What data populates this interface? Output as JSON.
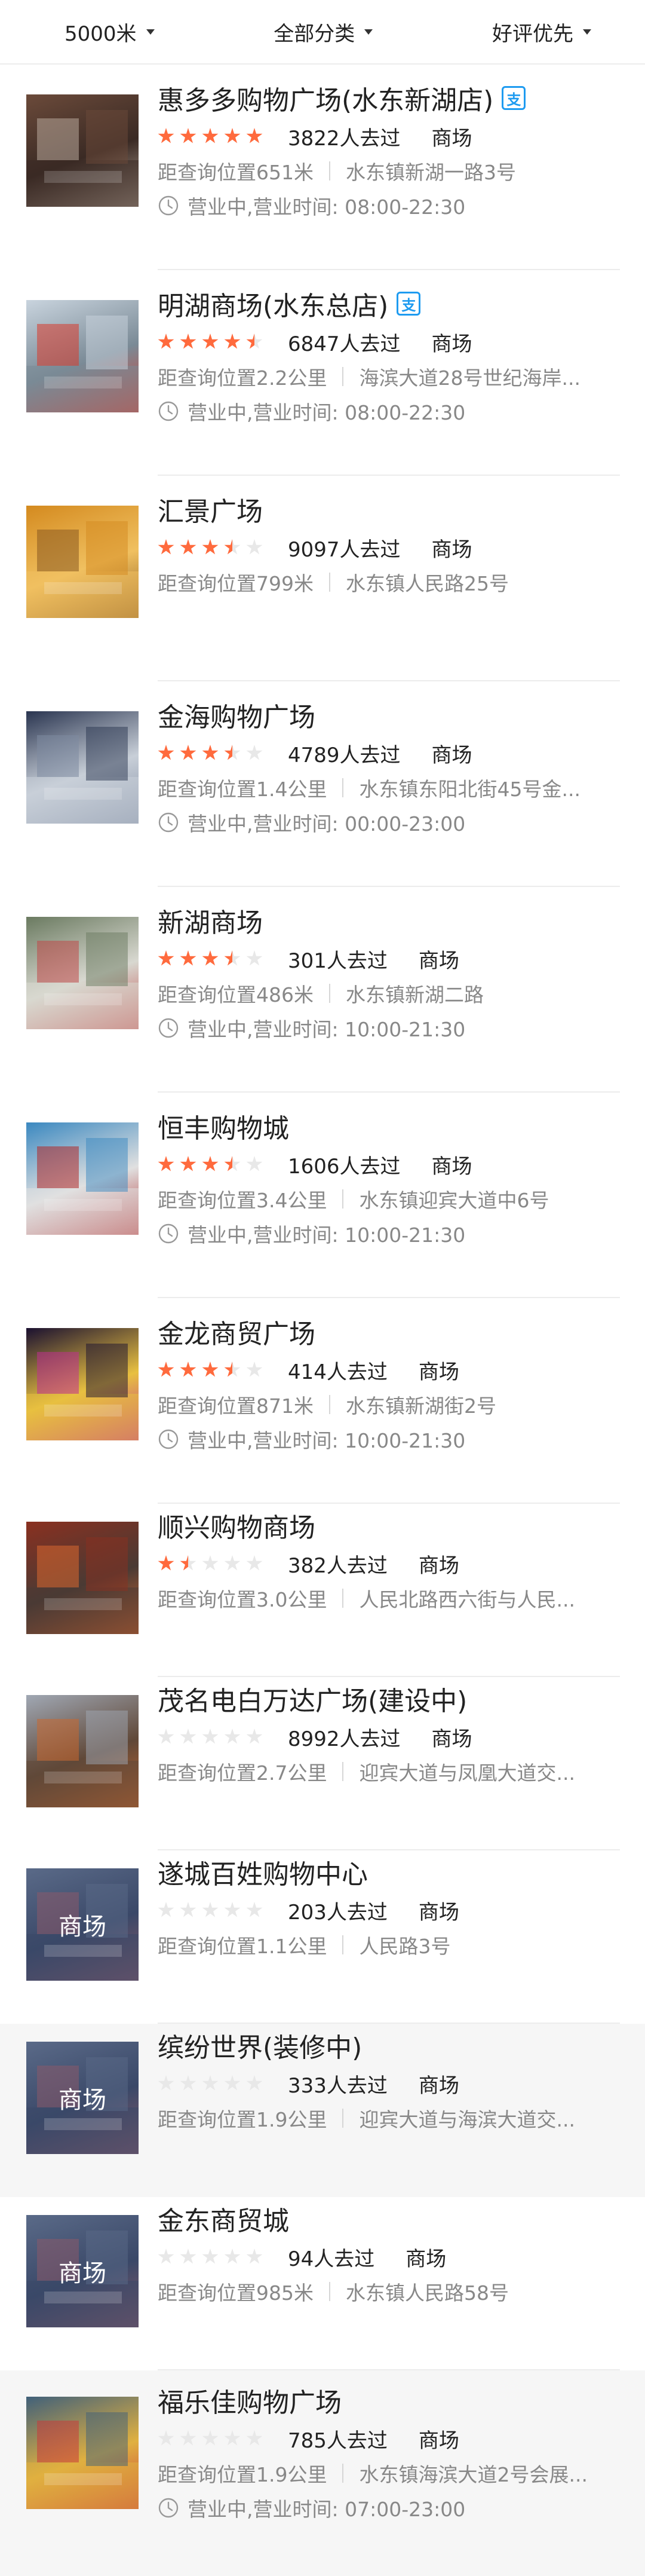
{
  "filters": {
    "distance": "5000米",
    "category": "全部分类",
    "sort": "好评优先"
  },
  "icons": {
    "caret": "caret-down-icon",
    "pay": "alipay-icon",
    "clock": "clock-icon",
    "star": "star-icon"
  },
  "colors": {
    "star_active": "#ff6a3d",
    "star_inactive": "#e8e8e8",
    "pay_icon": "#1e9bf0",
    "secondary_text": "#888888"
  },
  "stores": [
    {
      "name": "惠多多购物广场(水东新湖店)",
      "has_pay": true,
      "rating": 5,
      "visitors": "3822人去过",
      "category": "商场",
      "distance": "距查询位置651米",
      "address": "水东镇新湖一路3号",
      "hours": "营业中,营业时间: 08:00-22:30",
      "thumb_text": ""
    },
    {
      "name": "明湖商场(水东总店)",
      "has_pay": true,
      "rating": 4.5,
      "visitors": "6847人去过",
      "category": "商场",
      "distance": "距查询位置2.2公里",
      "address": "海滨大道28号世纪海岸...",
      "hours": "营业中,营业时间: 08:00-22:30",
      "thumb_text": ""
    },
    {
      "name": "汇景广场",
      "has_pay": false,
      "rating": 3.5,
      "visitors": "9097人去过",
      "category": "商场",
      "distance": "距查询位置799米",
      "address": "水东镇人民路25号",
      "hours": "",
      "thumb_text": ""
    },
    {
      "name": "金海购物广场",
      "has_pay": false,
      "rating": 3.5,
      "visitors": "4789人去过",
      "category": "商场",
      "distance": "距查询位置1.4公里",
      "address": "水东镇东阳北街45号金...",
      "hours": "营业中,营业时间: 00:00-23:00",
      "thumb_text": ""
    },
    {
      "name": "新湖商场",
      "has_pay": false,
      "rating": 3.5,
      "visitors": "301人去过",
      "category": "商场",
      "distance": "距查询位置486米",
      "address": "水东镇新湖二路",
      "hours": "营业中,营业时间: 10:00-21:30",
      "thumb_text": ""
    },
    {
      "name": "恒丰购物城",
      "has_pay": false,
      "rating": 3.5,
      "visitors": "1606人去过",
      "category": "商场",
      "distance": "距查询位置3.4公里",
      "address": "水东镇迎宾大道中6号",
      "hours": "营业中,营业时间: 10:00-21:30",
      "thumb_text": ""
    },
    {
      "name": "金龙商贸广场",
      "has_pay": false,
      "rating": 3.5,
      "visitors": "414人去过",
      "category": "商场",
      "distance": "距查询位置871米",
      "address": "水东镇新湖街2号",
      "hours": "营业中,营业时间: 10:00-21:30",
      "thumb_text": ""
    },
    {
      "name": "顺兴购物商场",
      "has_pay": false,
      "rating": 1.5,
      "visitors": "382人去过",
      "category": "商场",
      "distance": "距查询位置3.0公里",
      "address": "人民北路西六街与人民...",
      "hours": "",
      "thumb_text": ""
    },
    {
      "name": "茂名电白万达广场(建设中)",
      "has_pay": false,
      "rating": 0,
      "visitors": "8992人去过",
      "category": "商场",
      "distance": "距查询位置2.7公里",
      "address": "迎宾大道与凤凰大道交...",
      "hours": "",
      "thumb_text": ""
    },
    {
      "name": "遂城百姓购物中心",
      "has_pay": false,
      "rating": 0,
      "visitors": "203人去过",
      "category": "商场",
      "distance": "距查询位置1.1公里",
      "address": "人民路3号",
      "hours": "",
      "thumb_text": "商场"
    },
    {
      "name": "缤纷世界(装修中)",
      "has_pay": false,
      "rating": 0,
      "visitors": "333人去过",
      "category": "商场",
      "distance": "距查询位置1.9公里",
      "address": "迎宾大道与海滨大道交...",
      "hours": "",
      "thumb_text": "商场"
    },
    {
      "name": "金东商贸城",
      "has_pay": false,
      "rating": 0,
      "visitors": "94人去过",
      "category": "商场",
      "distance": "距查询位置985米",
      "address": "水东镇人民路58号",
      "hours": "",
      "thumb_text": "商场"
    },
    {
      "name": "福乐佳购物广场",
      "has_pay": false,
      "rating": 0,
      "visitors": "785人去过",
      "category": "商场",
      "distance": "距查询位置1.9公里",
      "address": "水东镇海滨大道2号会展...",
      "hours": "营业中,营业时间: 07:00-23:00",
      "thumb_text": ""
    }
  ]
}
